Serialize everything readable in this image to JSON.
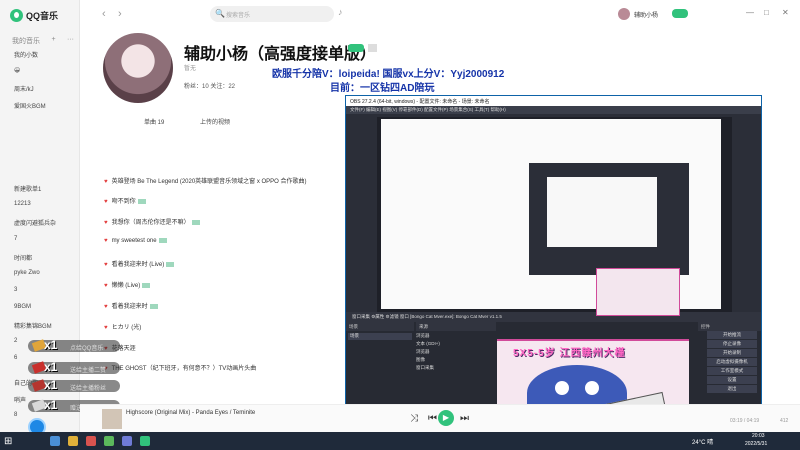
{
  "app": {
    "logo": "QQ音乐"
  },
  "sidebar": {
    "head_left": "我的音乐",
    "head_plus": "+",
    "head_more": "···",
    "items": [
      "我的小数",
      "😀",
      "周末/kJ",
      "爱国火BGM",
      "新建歌单1",
      "12213",
      "虚度闪避狐兵杂",
      "7",
      "时间都",
      "pyke Zwo",
      "3",
      "9BGM",
      "精彩集锦BGM",
      "2",
      "6",
      "自己的歌",
      "哨声",
      "8"
    ]
  },
  "topbar": {
    "back": "‹",
    "forward": "›",
    "search_placeholder": "搜索音乐",
    "search_icon": "🔍",
    "mic": "♪",
    "user_name": "辅助小杨",
    "win_min": "—",
    "win_max": "□",
    "win_close": "✕"
  },
  "profile": {
    "name": "辅助小杨（高强度接单版）",
    "sub": "暂无",
    "stats": "粉丝：10    关注：22"
  },
  "overlay": {
    "line1": "欧服千分陪V：loipeida! 国服vx上分V：Yyj2000912",
    "line2": "目前：一区钻四AD陪玩"
  },
  "tabs": {
    "songs": "单曲 19",
    "videos": "上传的视频"
  },
  "songs": [
    {
      "title": "英雄登场 Be The Legend (2020英雄联盟音乐领域之窗 x OPPO 合作歌曲)",
      "heart": "♥"
    },
    {
      "title": "吻不到你",
      "heart": "♥"
    },
    {
      "title": "我想你（周杰伦你还是不嘛）",
      "heart": "♥"
    },
    {
      "title": "my sweetest one",
      "heart": "♥"
    },
    {
      "title": "看着我迎来时 (Live)",
      "heart": "♥"
    },
    {
      "title": "懒懒 (Live)",
      "heart": "♥"
    },
    {
      "title": "看着我迎来时",
      "heart": "♥"
    },
    {
      "title": "ヒカリ (光)",
      "heart": "♥"
    },
    {
      "title": "花落天涯",
      "heart": "♥"
    },
    {
      "title": "THE GHOST（纪下班牙，有何意不？）TV动画片头曲",
      "heart": "♥"
    }
  ],
  "gifts": [
    {
      "count": "x1",
      "label": "点给QQ音乐"
    },
    {
      "count": "x1",
      "label": "送给主播二赞"
    },
    {
      "count": "x1",
      "label": "送给主播粉丝"
    },
    {
      "count": "x1",
      "label": "赠送主播三星"
    }
  ],
  "obs": {
    "title": "OBS 27.2.4 (64-bit, windows) - 配置文件: 未命名 - 场景: 未命名",
    "menu": "文件(F)   编辑(E)   视图(V)   停靠部件(D)   配置文件(P)   场景集合(S)   工具(T)   帮助(H)",
    "source_bar": "窗口采集         ⚙属性     ⚙滤镜     窗口   [Bongo Cat Mver.exe]: Bongo Cat Mver v1.1.5",
    "scene_header": "场景",
    "scene_item": "场景",
    "sources_header": "来源",
    "sources": [
      "浏览器",
      "文本 (GDI+)",
      "浏览器",
      "图像",
      "窗口采集"
    ],
    "controls_header": "控件",
    "controls": [
      "开始推流",
      "停止录像",
      "开始录制",
      "启动虚拟摄像机",
      "工作室模式",
      "设置",
      "退出"
    ]
  },
  "cat": {
    "caption": "5X5-5岁  江西赣州大槿"
  },
  "player": {
    "track": "Highscore (Original Mix) - Panda Eyes / Teminite",
    "time": "03:19 / 04:19",
    "count": "412",
    "prev": "⏮",
    "play": "▶",
    "next": "⏭",
    "shuffle": "⤨"
  },
  "taskbar": {
    "start": "⊞",
    "temp": "24°C 晴",
    "time": "20:03",
    "date": "2022/5/31"
  },
  "colors": {
    "accent": "#31c27c",
    "overlay_text": "#1533a8",
    "cat_caption": "#ff66c4"
  }
}
